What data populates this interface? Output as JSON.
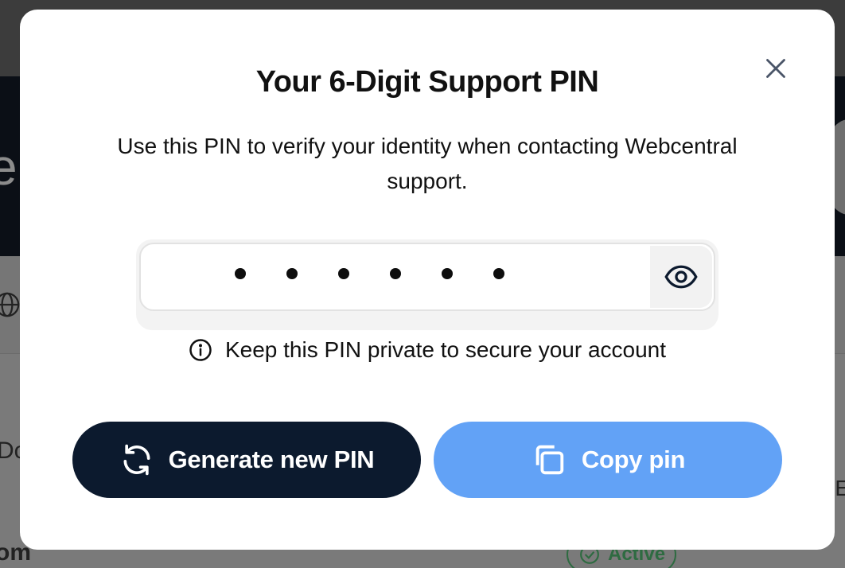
{
  "background": {
    "fragment_left_large": "e",
    "fragment_left_mid": "Do",
    "fragment_left_bottom": "om",
    "fragment_right": "E",
    "active_badge": "Active"
  },
  "modal": {
    "title": "Your 6-Digit Support PIN",
    "description": "Use this PIN to verify your identity when contacting Webcentral support.",
    "close_icon": "close-icon",
    "pin": {
      "masked_digits": 6,
      "visibility_icon": "eye-icon"
    },
    "hint": {
      "icon": "info-icon",
      "text": "Keep this PIN private to secure your account"
    },
    "buttons": {
      "generate_label": "Generate new PIN",
      "generate_icon": "refresh-icon",
      "copy_label": "Copy pin",
      "copy_icon": "copy-icon"
    }
  },
  "colors": {
    "primary_dark": "#0c1a2e",
    "copy_button": "#62a2f6",
    "overlay": "#7a7a7a"
  }
}
